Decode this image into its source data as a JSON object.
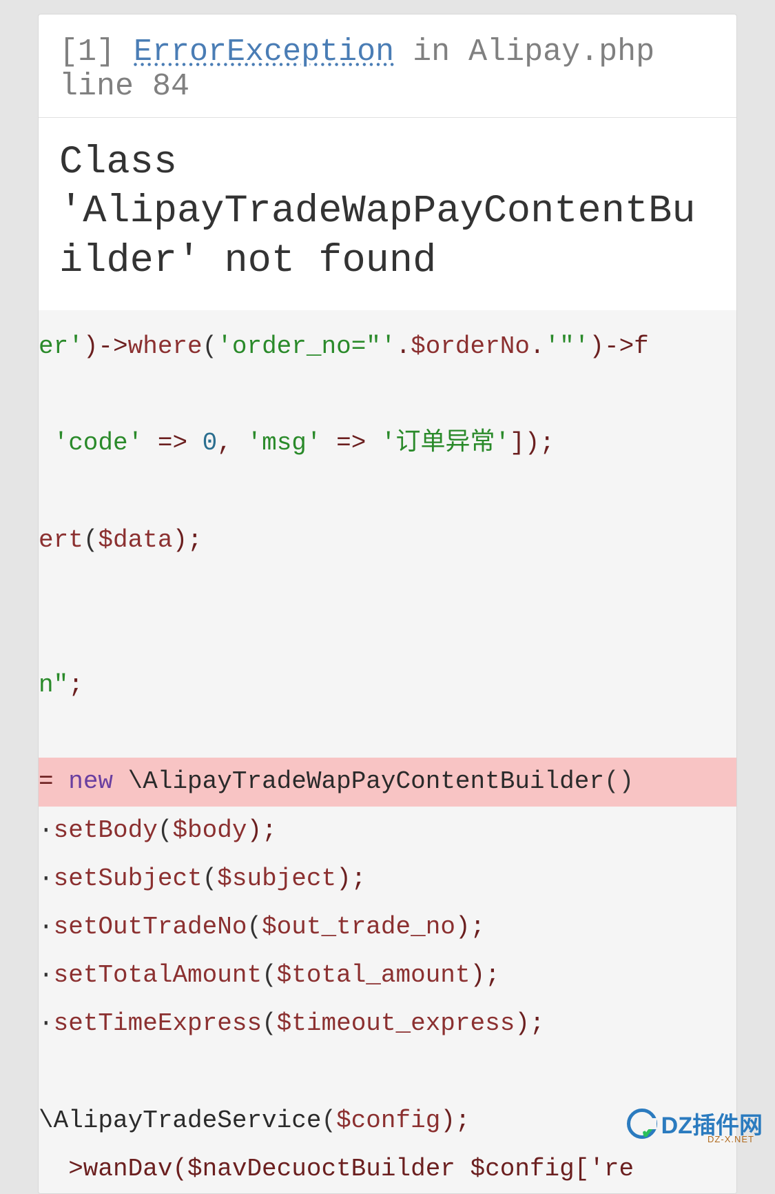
{
  "error": {
    "code": "[1]",
    "type": "ErrorException",
    "in_word": "in",
    "file": "Alipay.php line 84",
    "message": "Class 'AlipayTradeWapPayContentBuilder' not found"
  },
  "code": {
    "line1": {
      "part1": "er'",
      "op1": ")->",
      "func1": "where",
      "paren1": "(",
      "str1": "'order_no=\"'",
      "op2": ".",
      "var1": "$orderNo",
      "op3": ".",
      "str2": "'\"'",
      "rest": ")->f"
    },
    "line2": {
      "str1": " 'code'",
      "op1": " => ",
      "num1": "0",
      "op2": ", ",
      "str2": "'msg'",
      "op3": " => ",
      "str3": "'订单异常'",
      "rest": "]);"
    },
    "line3": {
      "func1": "ert",
      "paren1": "(",
      "var1": "$data",
      "rest": ");"
    },
    "line4": {
      "str1": "n\"",
      "rest": ";"
    },
    "highlight": {
      "eq": "= ",
      "kw": "new",
      "sp": " ",
      "cls": "\\AlipayTradeWapPayContentBuilder",
      "paren": "()"
    },
    "line6": {
      "prefix": "·",
      "func": "setBody",
      "paren1": "(",
      "var": "$body",
      "rest": ");"
    },
    "line7": {
      "prefix": "·",
      "func": "setSubject",
      "paren1": "(",
      "var": "$subject",
      "rest": ");"
    },
    "line8": {
      "prefix": "·",
      "func": "setOutTradeNo",
      "paren1": "(",
      "var": "$out_trade_no",
      "rest": ");"
    },
    "line9": {
      "prefix": "·",
      "func": "setTotalAmount",
      "paren1": "(",
      "var": "$total_amount",
      "rest": ");"
    },
    "line10": {
      "prefix": "·",
      "func": "setTimeExpress",
      "paren1": "(",
      "var": "$timeout_express",
      "rest": ");"
    },
    "line11": {
      "cls": "\\AlipayTradeService",
      "paren1": "(",
      "var": "$config",
      "rest": ");"
    },
    "line12": {
      "partial": "  >wanDav($navDecuoctBuilder $config['re"
    }
  },
  "watermark": {
    "text": "DZ插件网",
    "sub": "DZ-X.NET"
  }
}
